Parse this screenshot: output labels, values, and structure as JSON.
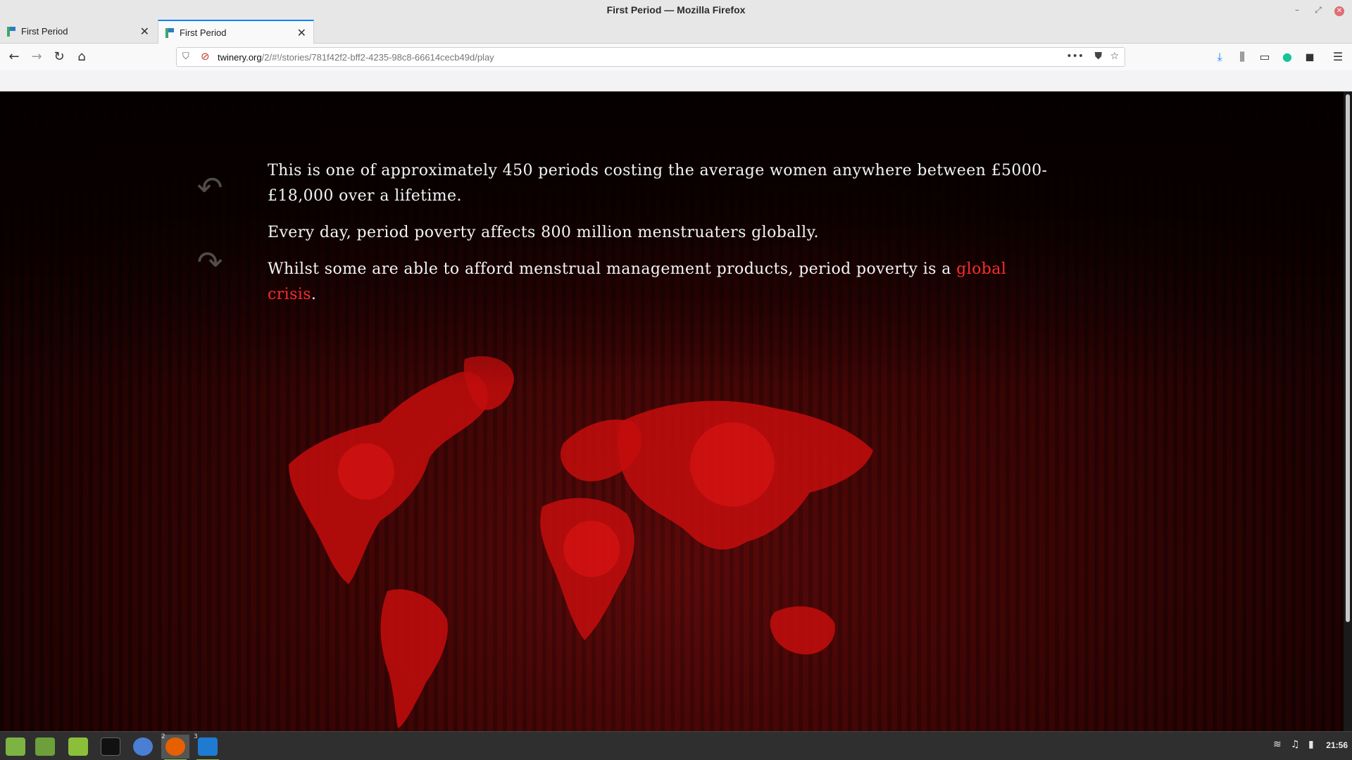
{
  "window": {
    "title": "First Period — Mozilla Firefox"
  },
  "tabs": [
    {
      "label": "First Period",
      "active": false
    },
    {
      "label": "First Period",
      "active": true
    }
  ],
  "nav": {
    "url_host": "twinery.org",
    "url_path": "/2/#!/stories/781f42f2-bff2-4235-98c8-66614cecb49d/play"
  },
  "story": {
    "paragraphs": [
      "This is one of approximately 450 periods costing the average women anywhere between £5000-£18,000 over a lifetime.",
      "Every day, period poverty affects 800 million menstruaters globally."
    ],
    "p3_prefix": "Whilst some are able to afford menstrual management products, period poverty is a ",
    "p3_link": "global crisis",
    "p3_suffix": ".",
    "undo_icon": "undo-icon",
    "redo_icon": "redo-icon"
  },
  "taskbar": {
    "items": [
      {
        "name": "mint-menu-icon"
      },
      {
        "name": "show-desktop-icon"
      },
      {
        "name": "files-icon"
      },
      {
        "name": "terminal-icon"
      },
      {
        "name": "chromium-icon"
      },
      {
        "name": "firefox-icon",
        "badge": "2"
      },
      {
        "name": "vscode-icon",
        "badge": "3"
      }
    ],
    "clock": "21:56"
  },
  "colors": {
    "accent": "#0a84ff",
    "link": "#ff2c2c",
    "map": "#c40d0d"
  }
}
